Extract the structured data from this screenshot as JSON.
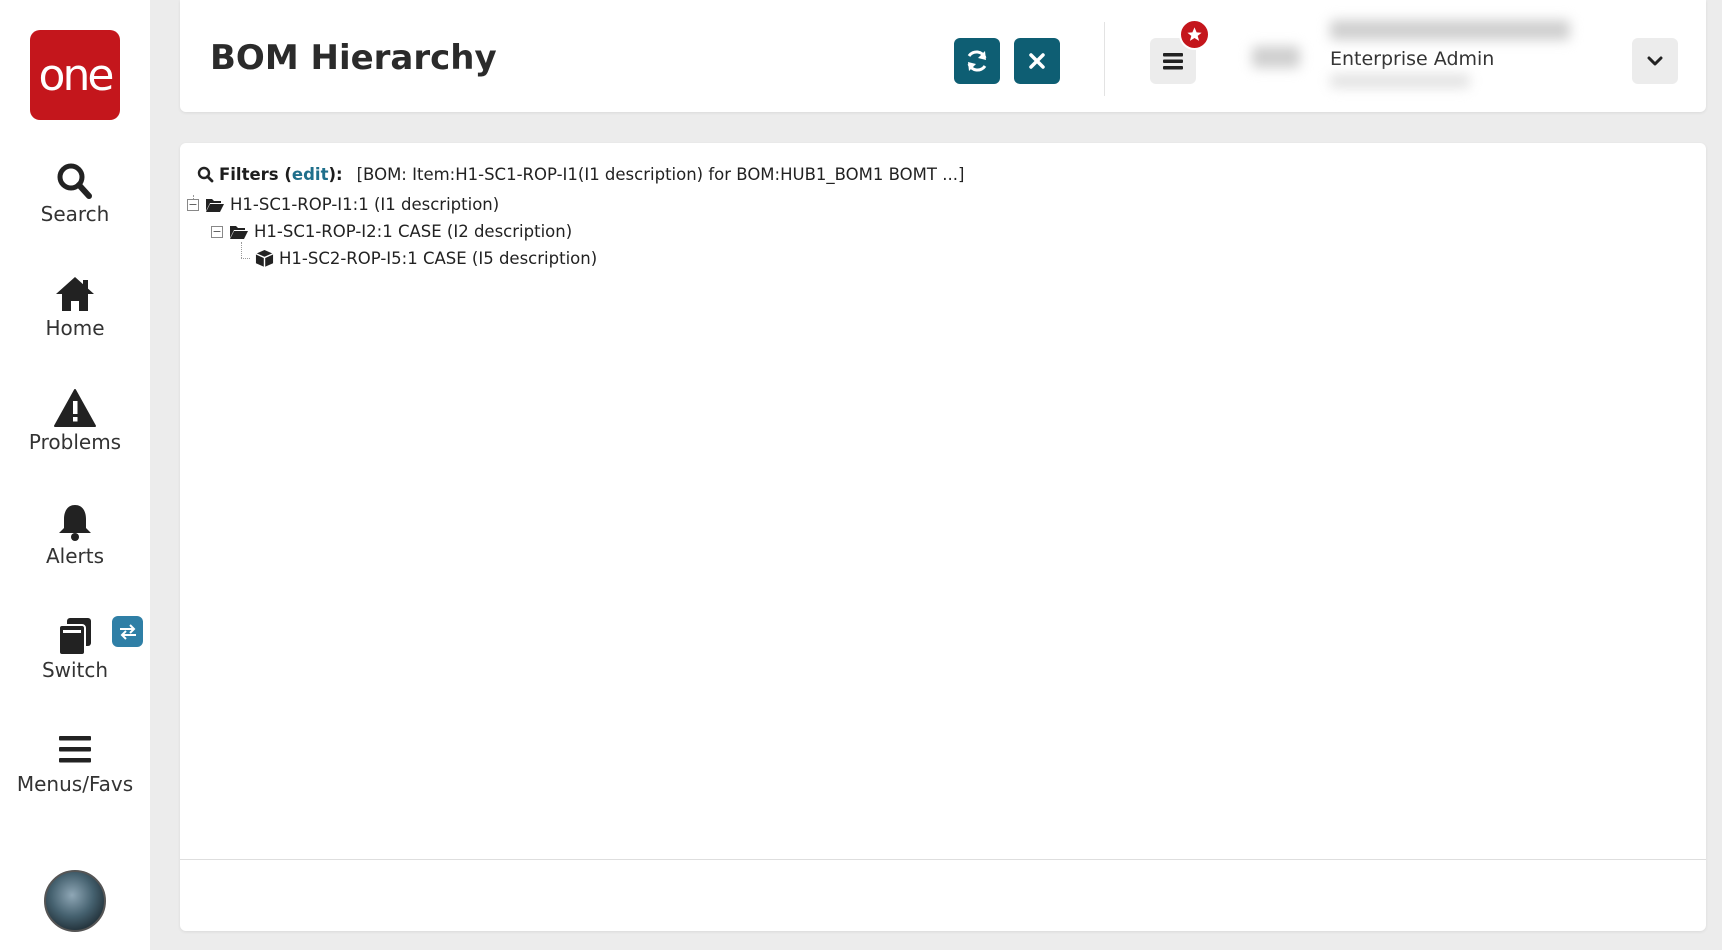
{
  "app": {
    "logo_text": "one",
    "brand_color": "#c4161c",
    "accent_color": "#0e5e73"
  },
  "sidebar": {
    "items": [
      {
        "label": "Search",
        "icon": "search-icon"
      },
      {
        "label": "Home",
        "icon": "home-icon"
      },
      {
        "label": "Problems",
        "icon": "warning-icon"
      },
      {
        "label": "Alerts",
        "icon": "bell-icon"
      },
      {
        "label": "Switch",
        "icon": "switch-icon"
      },
      {
        "label": "Menus/Favs",
        "icon": "menu-icon"
      }
    ]
  },
  "header": {
    "title": "BOM Hierarchy",
    "refresh_icon": "refresh-icon",
    "close_icon": "close-icon",
    "user_role": "Enterprise Admin"
  },
  "filters": {
    "label": "Filters",
    "edit_label": "edit",
    "value": "[BOM: Item:H1-SC1-ROP-I1(I1 description) for BOM:HUB1_BOM1 BOMT ...]"
  },
  "tree": {
    "nodes": [
      {
        "label": "H1-SC1-ROP-I1:1 (I1 description)",
        "icon": "folder-open-icon",
        "expanded": true
      },
      {
        "label": "H1-SC1-ROP-I2:1 CASE (I2 description)",
        "icon": "folder-open-icon",
        "expanded": true
      },
      {
        "label": "H1-SC2-ROP-I5:1 CASE (I5 description)",
        "icon": "cube-icon"
      }
    ]
  }
}
